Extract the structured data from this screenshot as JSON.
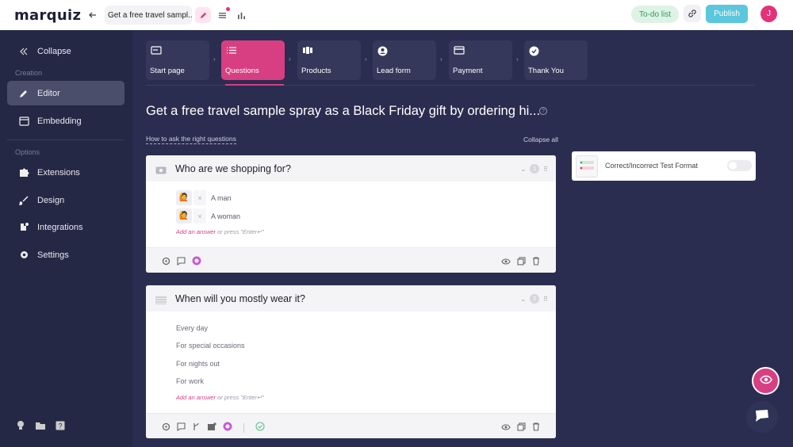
{
  "topbar": {
    "logo": "marquiz",
    "quiz_title": "Get a free travel sampl...",
    "todo_label": "To-do list",
    "publish_label": "Publish",
    "avatar_initial": "J"
  },
  "sidebar": {
    "collapse": "Collapse",
    "section_creation": "Creation",
    "editor": "Editor",
    "embedding": "Embedding",
    "section_options": "Options",
    "extensions": "Extensions",
    "design": "Design",
    "integrations": "Integrations",
    "settings": "Settings"
  },
  "steps": [
    {
      "label": "Start page"
    },
    {
      "label": "Questions"
    },
    {
      "label": "Products"
    },
    {
      "label": "Lead form"
    },
    {
      "label": "Payment"
    },
    {
      "label": "Thank You"
    }
  ],
  "main": {
    "title": "Get a free travel sample spray as a Black Friday gift by ordering hi...",
    "howto": "How to ask the right questions",
    "collapse_all": "Collapse all"
  },
  "questions": [
    {
      "title": "Who are we shopping for?",
      "number": "1",
      "answers": [
        "A man",
        "A woman"
      ],
      "add_answer": "Add an answer",
      "add_hint": " or press \"Enter↵\""
    },
    {
      "title": "When will you mostly wear it?",
      "number": "2",
      "answers": [
        "Every day",
        "For special occasions",
        "For nights out",
        "For work"
      ],
      "add_answer": "Add an answer",
      "add_hint": " or press \"Enter↵\""
    }
  ],
  "side_panel": {
    "label": "Correct/Incorrect Test Format",
    "toggle_on": false
  },
  "colors": {
    "accent": "#d83e82",
    "sidebar_bg": "#252845",
    "main_bg": "#2a2d4f",
    "publish": "#5bc6dc"
  }
}
